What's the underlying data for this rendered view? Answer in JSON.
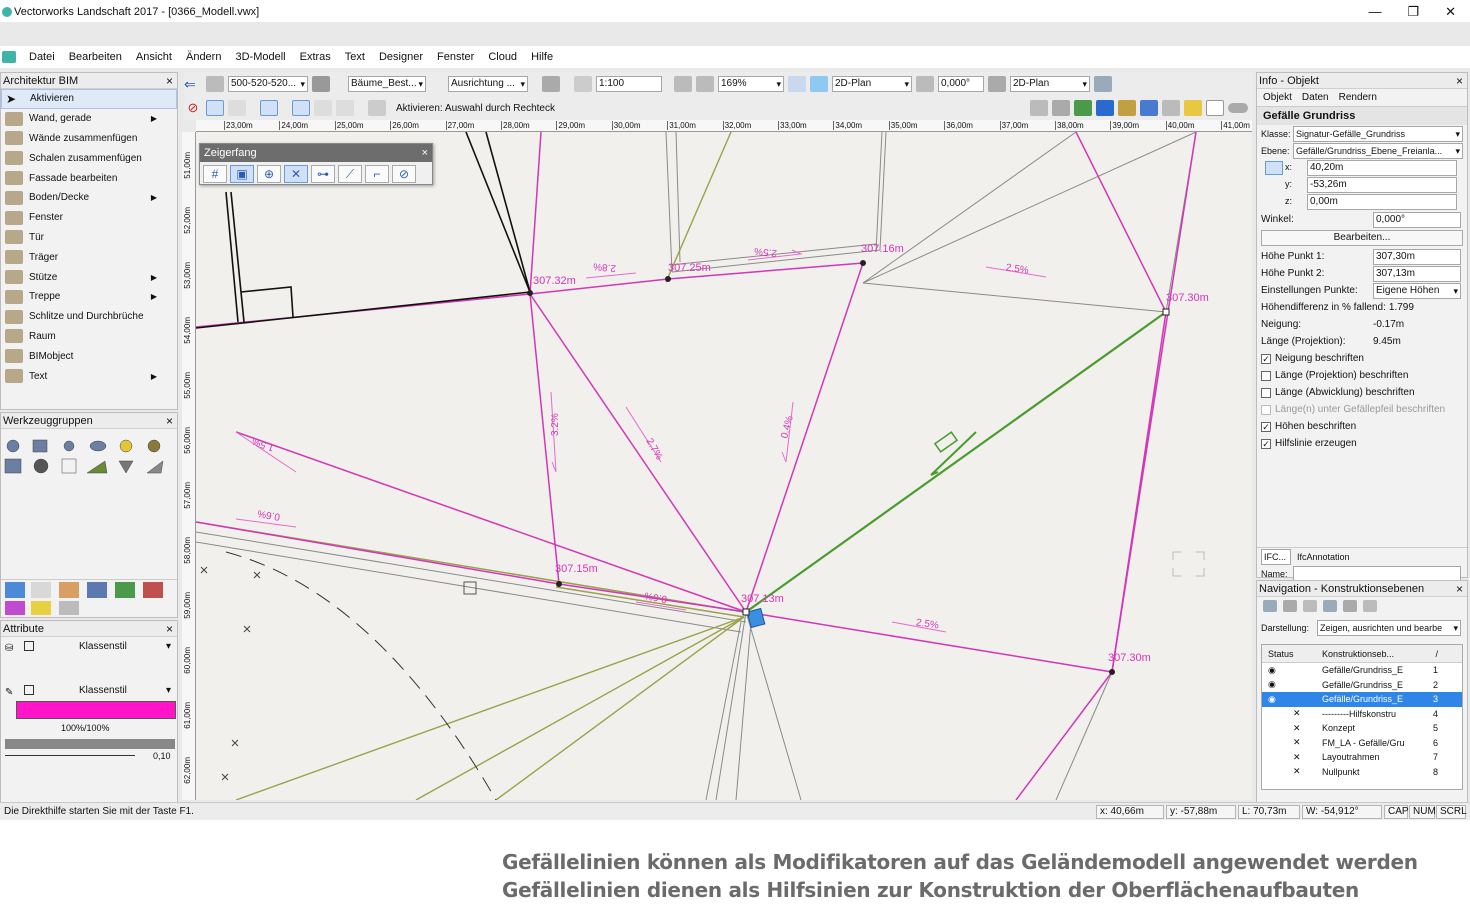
{
  "window": {
    "title": "Vectorworks Landschaft 2017 - [0366_Modell.vwx]"
  },
  "menu": [
    "Datei",
    "Bearbeiten",
    "Ansicht",
    "Ändern",
    "3D-Modell",
    "Extras",
    "Text",
    "Designer",
    "Fenster",
    "Cloud",
    "Hilfe"
  ],
  "toolbar": {
    "layer_field": "500-520-520...",
    "class_field": "Bäume_Best...",
    "align_field": "Ausrichtung ...",
    "scale_field": "1:100",
    "zoom_field": "169%",
    "view_field": "2D-Plan",
    "angle_field": "0,000°",
    "view2_field": "2D-Plan",
    "mode_text": "Aktivieren: Auswahl durch Rechteck"
  },
  "left_panel": {
    "title": "Architektur BIM",
    "tools": [
      {
        "label": "Aktivieren",
        "icon": "arrow-cursor-icon",
        "sub": false
      },
      {
        "label": "Wand, gerade",
        "icon": "wall-icon",
        "sub": true
      },
      {
        "label": "Wände zusammenfügen",
        "icon": "join-walls-icon",
        "sub": false
      },
      {
        "label": "Schalen zusammenfügen",
        "icon": "join-shells-icon",
        "sub": false
      },
      {
        "label": "Fassade bearbeiten",
        "icon": "facade-icon",
        "sub": false
      },
      {
        "label": "Boden/Decke",
        "icon": "slab-icon",
        "sub": true
      },
      {
        "label": "Fenster",
        "icon": "window-icon",
        "sub": false
      },
      {
        "label": "Tür",
        "icon": "door-icon",
        "sub": false
      },
      {
        "label": "Träger",
        "icon": "beam-icon",
        "sub": false
      },
      {
        "label": "Stütze",
        "icon": "column-icon",
        "sub": true
      },
      {
        "label": "Treppe",
        "icon": "stair-icon",
        "sub": true
      },
      {
        "label": "Schlitze und Durchbrüche",
        "icon": "opening-icon",
        "sub": false
      },
      {
        "label": "Raum",
        "icon": "space-icon",
        "sub": false
      },
      {
        "label": "BIMobject",
        "icon": "bimobject-icon",
        "sub": false
      },
      {
        "label": "Text",
        "icon": "text-tool-icon",
        "sub": true
      }
    ]
  },
  "tool_groups": {
    "title": "Werkzeuggruppen"
  },
  "attributes": {
    "title": "Attribute",
    "fill_style": "Klassenstil",
    "pen_style": "Klassenstil",
    "opacity": "100%/100%",
    "line_weight": "0,10",
    "fill_color": "#ff14c8"
  },
  "snap_palette": {
    "title": "Zeigerfang"
  },
  "ruler_top": [
    "23,00m",
    "24,00m",
    "25,00m",
    "26,00m",
    "27,00m",
    "28,00m",
    "29,00m",
    "30,00m",
    "31,00m",
    "32,00m",
    "33,00m",
    "34,00m",
    "35,00m",
    "36,00m",
    "37,00m",
    "38,00m",
    "39,00m",
    "40,00m",
    "41,00m"
  ],
  "ruler_left": [
    "51,00m",
    "52,00m",
    "53,00m",
    "54,00m",
    "55,00m",
    "56,00m",
    "57,00m",
    "58,00m",
    "59,00m",
    "60,00m",
    "61,00m",
    "62,00m"
  ],
  "drawing": {
    "heights": [
      "307.32m",
      "307.25m",
      "307.16m",
      "307.30m",
      "307.15m",
      "307.13m",
      "307.30m"
    ],
    "slopes": [
      "2.8%",
      "2.5%",
      "2.5%",
      "3.2%",
      "2.7%",
      "0.4%",
      "1.5%",
      "0.6%",
      "0.6%",
      "2.5%",
      "1.8%"
    ]
  },
  "info_panel": {
    "title": "Info - Objekt",
    "tabs": [
      "Objekt",
      "Daten",
      "Rendern"
    ],
    "object_type": "Gefälle Grundriss",
    "class_label": "Klasse:",
    "class_value": "Signatur-Gefälle_Grundriss",
    "layer_label": "Ebene:",
    "layer_value": "Gefälle/Grundriss_Ebene_Freianla...",
    "x_label": "x:",
    "x_value": "40,20m",
    "y_label": "y:",
    "y_value": "-53,26m",
    "z_label": "z:",
    "z_value": "0,00m",
    "angle_label": "Winkel:",
    "angle_value": "0,000°",
    "edit_button": "Bearbeiten...",
    "h1_label": "Höhe Punkt 1:",
    "h1_value": "307,30m",
    "h2_label": "Höhe Punkt 2:",
    "h2_value": "307,13m",
    "points_label": "Einstellungen Punkte:",
    "points_value": "Eigene Höhen",
    "diff_label": "Höhendifferenz in % fallend:",
    "diff_value": "1.799",
    "slope_label": "Neigung:",
    "slope_value": "-0.17m",
    "length_label": "Länge (Projektion):",
    "length_value": "9.45m",
    "checks": [
      {
        "label": "Neigung beschriften",
        "checked": true,
        "disabled": false
      },
      {
        "label": "Länge (Projektion) beschriften",
        "checked": false,
        "disabled": false
      },
      {
        "label": "Länge (Abwicklung) beschriften",
        "checked": false,
        "disabled": false
      },
      {
        "label": "Länge(n) unter Gefällepfeil beschriften",
        "checked": false,
        "disabled": true
      },
      {
        "label": "Höhen beschriften",
        "checked": true,
        "disabled": false
      },
      {
        "label": "Hilfslinie erzeugen",
        "checked": true,
        "disabled": false
      }
    ],
    "ifc_button": "IFC...",
    "ifc_value": "IfcAnnotation",
    "name_label": "Name:"
  },
  "nav_panel": {
    "title": "Navigation - Konstruktionsebenen",
    "display_label": "Darstellung:",
    "display_value": "Zeigen, ausrichten und bearbe",
    "col_status": "Status",
    "col_name": "Konstruktionseb...",
    "col_sep": "/",
    "layers": [
      {
        "name": "Gefälle/Grundriss_E",
        "num": "1",
        "status": "eye",
        "hi": false
      },
      {
        "name": "Gefälle/Grundriss_E",
        "num": "2",
        "status": "eye",
        "hi": false
      },
      {
        "name": "Gefälle/Grundriss_E",
        "num": "3",
        "status": "eye",
        "hi": true
      },
      {
        "name": "---------Hilfskonstru",
        "num": "4",
        "status": "x",
        "hi": false
      },
      {
        "name": "Konzept",
        "num": "5",
        "status": "x",
        "hi": false
      },
      {
        "name": "FM_LA - Gefälle/Gru",
        "num": "6",
        "status": "x",
        "hi": false
      },
      {
        "name": "Layoutrahmen",
        "num": "7",
        "status": "x",
        "hi": false
      },
      {
        "name": "Nullpunkt",
        "num": "8",
        "status": "x",
        "hi": false
      }
    ]
  },
  "status": {
    "help": "Die Direkthilfe starten Sie mit der Taste F1.",
    "x": "x: 40,66m",
    "y": "y: -57,88m",
    "l": "L: 70,73m",
    "w": "W: -54,912°",
    "cap": "CAP",
    "num": "NUM",
    "scrl": "SCRL"
  },
  "caption": {
    "line1": "Gefällelinien können als Modifikatoren auf das Geländemodell angewendet werden",
    "line2": "Gefällelinien dienen als Hilfsinien zur Konstruktion der Oberflächenaufbauten"
  },
  "colors": {
    "magenta": "#e23ac8",
    "green": "#4a9b2e",
    "olive": "#9aa24a",
    "grey": "#8a8a8a",
    "select": "#2f86e6"
  }
}
